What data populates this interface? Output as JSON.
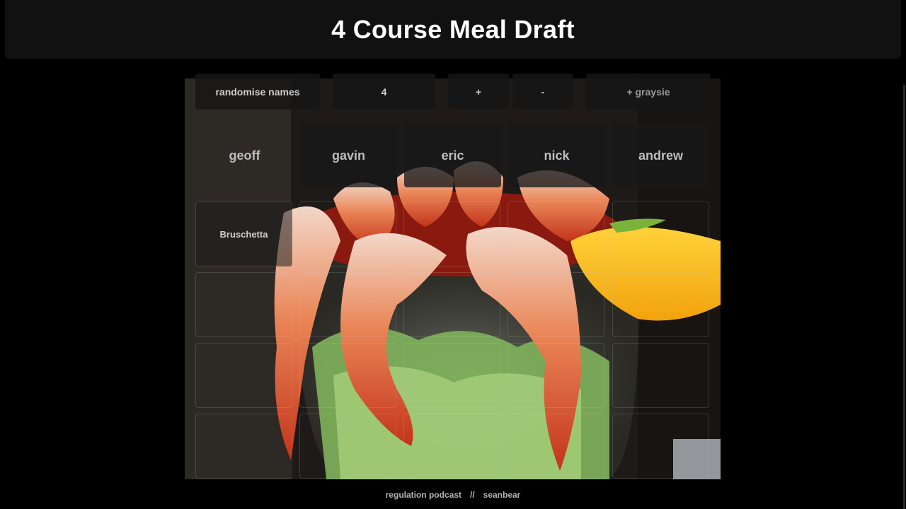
{
  "header": {
    "title": "4 Course Meal Draft"
  },
  "controls": {
    "randomise_label": "randomise names",
    "count_value": "4",
    "plus_label": "+",
    "minus_label": "-",
    "add_player_label": "+ graysie"
  },
  "players": [
    "geoff",
    "gavin",
    "eric",
    "nick",
    "andrew"
  ],
  "picks": {
    "row1": [
      "Bruschetta",
      "",
      "",
      "",
      ""
    ],
    "row2": [
      "",
      "",
      "",
      "",
      ""
    ],
    "row3": [
      "",
      "",
      "",
      "",
      ""
    ],
    "row4": [
      "",
      "",
      "",
      "",
      ""
    ]
  },
  "footer": {
    "left_link": "regulation podcast",
    "separator": "//",
    "right_link": "seanbear"
  },
  "background_image": "shrimp-cocktail-photo"
}
